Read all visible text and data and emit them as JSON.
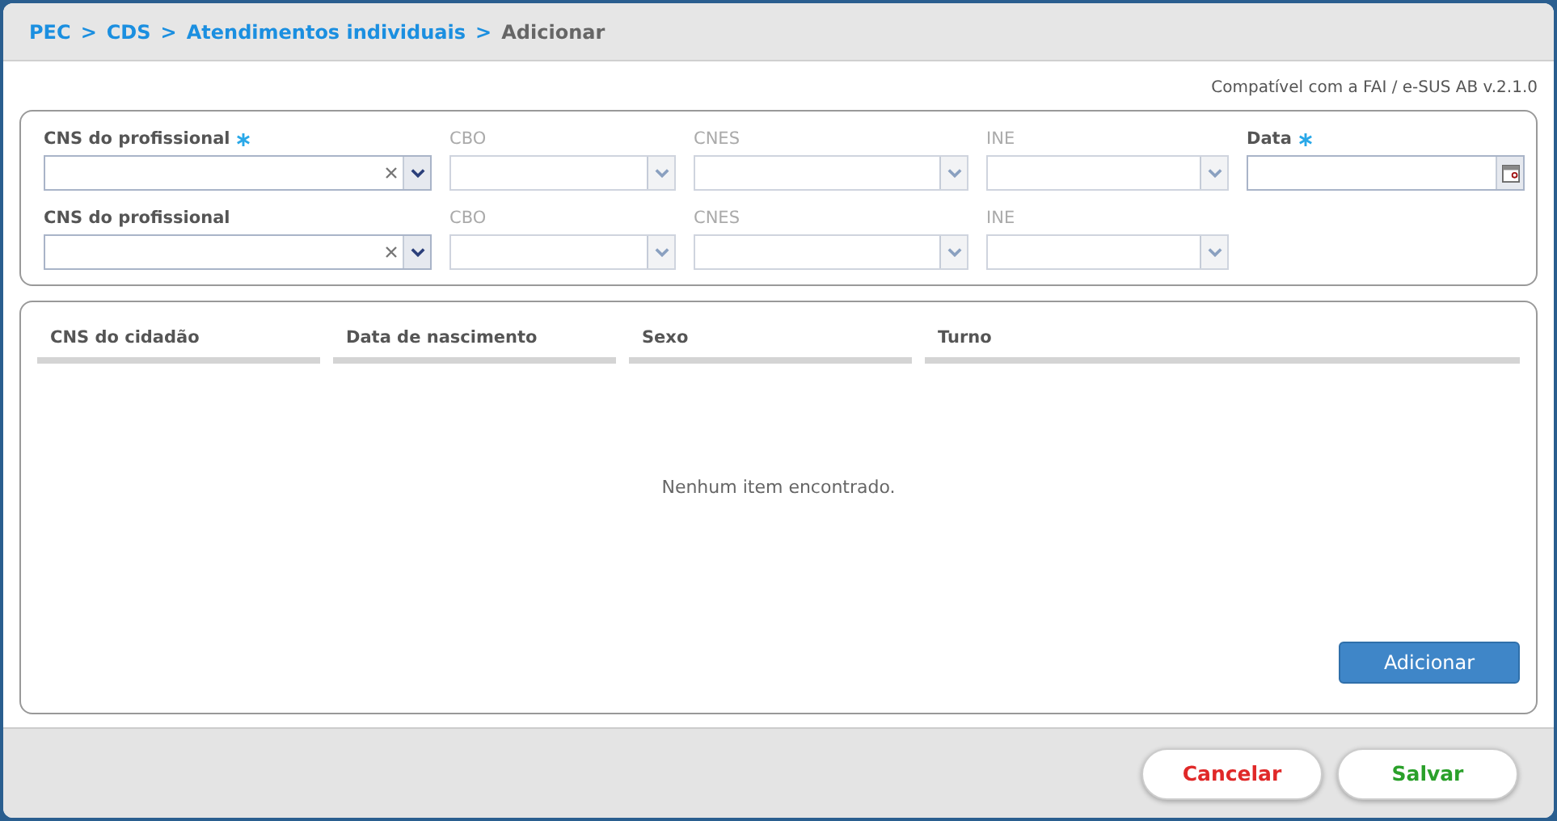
{
  "breadcrumb": [
    {
      "label": "PEC",
      "link": true
    },
    {
      "label": "CDS",
      "link": true
    },
    {
      "label": "Atendimentos individuais",
      "link": true
    },
    {
      "label": "Adicionar",
      "link": false
    }
  ],
  "breadcrumb_separator": ">",
  "compatibility_note": "Compatível com a FAI / e-SUS AB v.2.1.0",
  "field_rows": [
    [
      {
        "label": "CNS do profissional",
        "required": true,
        "disabled": false,
        "kind": "combo-clear"
      },
      {
        "label": "CBO",
        "required": false,
        "disabled": true,
        "kind": "combo"
      },
      {
        "label": "CNES",
        "required": false,
        "disabled": true,
        "kind": "combo"
      },
      {
        "label": "INE",
        "required": false,
        "disabled": true,
        "kind": "combo"
      },
      {
        "label": "Data",
        "required": true,
        "disabled": false,
        "kind": "date"
      }
    ],
    [
      {
        "label": "CNS do profissional",
        "required": false,
        "disabled": false,
        "kind": "combo-clear"
      },
      {
        "label": "CBO",
        "required": false,
        "disabled": true,
        "kind": "combo"
      },
      {
        "label": "CNES",
        "required": false,
        "disabled": true,
        "kind": "combo"
      },
      {
        "label": "INE",
        "required": false,
        "disabled": true,
        "kind": "combo"
      }
    ]
  ],
  "table": {
    "columns": [
      "CNS do cidadão",
      "Data de nascimento",
      "Sexo",
      "Turno"
    ],
    "empty_message": "Nenhum item encontrado."
  },
  "add_button": "Adicionar",
  "buttons": [
    {
      "label": "Cancelar",
      "kind": "cancel"
    },
    {
      "label": "Salvar",
      "kind": "save"
    }
  ]
}
